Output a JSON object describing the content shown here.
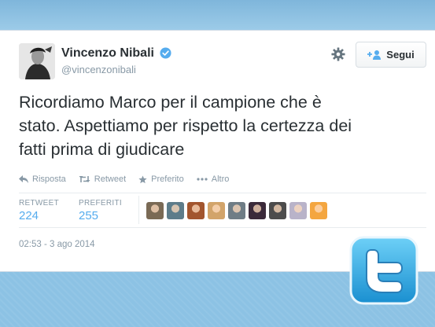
{
  "user": {
    "name": "Vincenzo Nibali",
    "handle": "@vincenzonibali"
  },
  "header": {
    "follow_label": "Segui"
  },
  "tweet": {
    "lines": [
      "Ricordiamo Marco per il campione che è",
      "stato. Aspettiamo per rispetto la certezza dei",
      "fatti prima di giudicare"
    ]
  },
  "actions": {
    "reply": "Risposta",
    "retweet": "Retweet",
    "favorite": "Preferito",
    "more": "Altro"
  },
  "stats": {
    "retweets_label": "RETWEET",
    "retweets_value": "224",
    "favorites_label": "PREFERITI",
    "favorites_value": "255"
  },
  "favoriters": [
    {
      "color": "#7a6a55"
    },
    {
      "color": "#5d7c8a"
    },
    {
      "color": "#a2552e"
    },
    {
      "color": "#d2a46a"
    },
    {
      "color": "#6f7d86"
    },
    {
      "color": "#3b2a3a"
    },
    {
      "color": "#4c4c4c"
    },
    {
      "color": "#b9b3c9"
    },
    {
      "color": "#f4a640"
    }
  ],
  "timestamp": "02:53 - 3 ago 2014",
  "colors": {
    "accent": "#55acee",
    "text": "#292f33",
    "muted": "#8899a6"
  }
}
